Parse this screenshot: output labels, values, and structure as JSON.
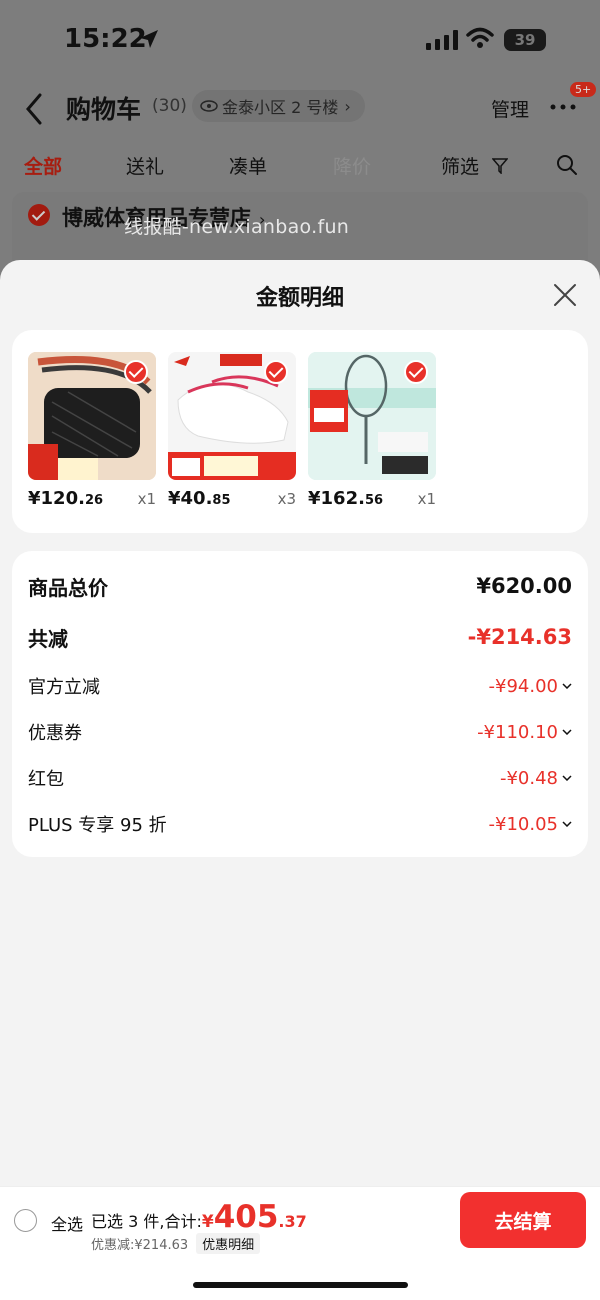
{
  "status": {
    "time": "15:22",
    "battery": "39"
  },
  "nav": {
    "title": "购物车",
    "count": "(30)",
    "address": "金泰小区 2 号楼",
    "address_chevron": "›",
    "manage": "管理",
    "badge": "5+"
  },
  "tabs": [
    {
      "label": "全部"
    },
    {
      "label": "送礼"
    },
    {
      "label": "凑单"
    },
    {
      "label": "降价"
    },
    {
      "label": "筛选"
    }
  ],
  "shop": {
    "name": "博威体育用品专营店",
    "chevron": "›"
  },
  "watermark": "线报酷-new.xianbao.fun",
  "sheet": {
    "title": "金额明细",
    "items": [
      {
        "price_int": "¥120.",
        "price_dec": "26",
        "qty": "x1",
        "image": "bag-product-image"
      },
      {
        "price_int": "¥40.",
        "price_dec": "85",
        "qty": "x3",
        "image": "socks-product-image"
      },
      {
        "price_int": "¥162.",
        "price_dec": "56",
        "qty": "x1",
        "image": "racket-product-image"
      }
    ],
    "details": {
      "total_label": "商品总价",
      "total_value": "¥620.00",
      "reduce_label": "共减",
      "reduce_value": "-¥214.63",
      "rows": [
        {
          "label": "官方立减",
          "value": "-¥94.00"
        },
        {
          "label": "优惠券",
          "value": "-¥110.10"
        },
        {
          "label": "红包",
          "value": "-¥0.48"
        },
        {
          "label": "PLUS 专享 95 折",
          "value": "-¥10.05"
        }
      ]
    }
  },
  "bottom": {
    "select_all": "全选",
    "selected_text": "已选 3 件,合计:",
    "yen": "¥",
    "total_int": "405",
    "total_dec": ".37",
    "discount": "优惠减:¥214.63",
    "detail_btn": "优惠明细",
    "checkout": "去结算"
  },
  "colors": {
    "accent": "#e8312a",
    "checkout": "#f2302f"
  }
}
